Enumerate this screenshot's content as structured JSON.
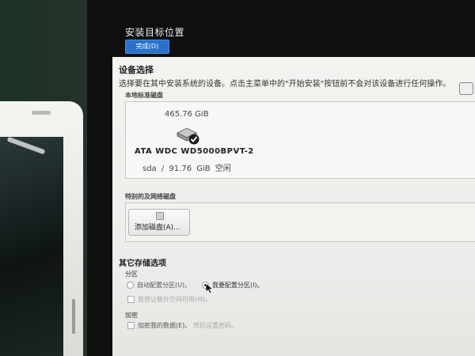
{
  "window": {
    "title": "安装目标位置",
    "done_label": "完成(D)"
  },
  "device_selection": {
    "title": "设备选择",
    "description": "选择要在其中安装系统的设备。点击主菜单中的\"开始安装\"按钮前不会对该设备进行任何操作。",
    "local_disks_label": "本地标准磁盘",
    "disk": {
      "size": "465.76 GiB",
      "name": "ATA WDC WD5000BPVT-2",
      "device": "sda",
      "separator": "/",
      "free": "91.76 GiB 空闲",
      "selected": true
    },
    "special_disks_label": "特别的及网络磁盘",
    "add_disk_label": "添加磁盘(A)..."
  },
  "other_storage": {
    "title": "其它存储选项",
    "partition_label": "分区",
    "auto_partition": "自动配置分区(U)。",
    "manual_partition": "我要配置分区(I)。",
    "manual_selected": true,
    "extra_space": "我想让额外空间可用(M)。",
    "encryption_label": "加密",
    "encrypt_data": "加密我的数据(E)。",
    "encrypt_hint": "然后设置密码。"
  },
  "colors": {
    "accent": "#2a72c9",
    "panel": "#f3f3f0"
  },
  "icons": {
    "disk": "hard-disk-icon",
    "check": "checkmark-icon",
    "add_disk": "disk-add-icon",
    "cursor": "mouse-cursor-icon",
    "help": "help-icon"
  }
}
